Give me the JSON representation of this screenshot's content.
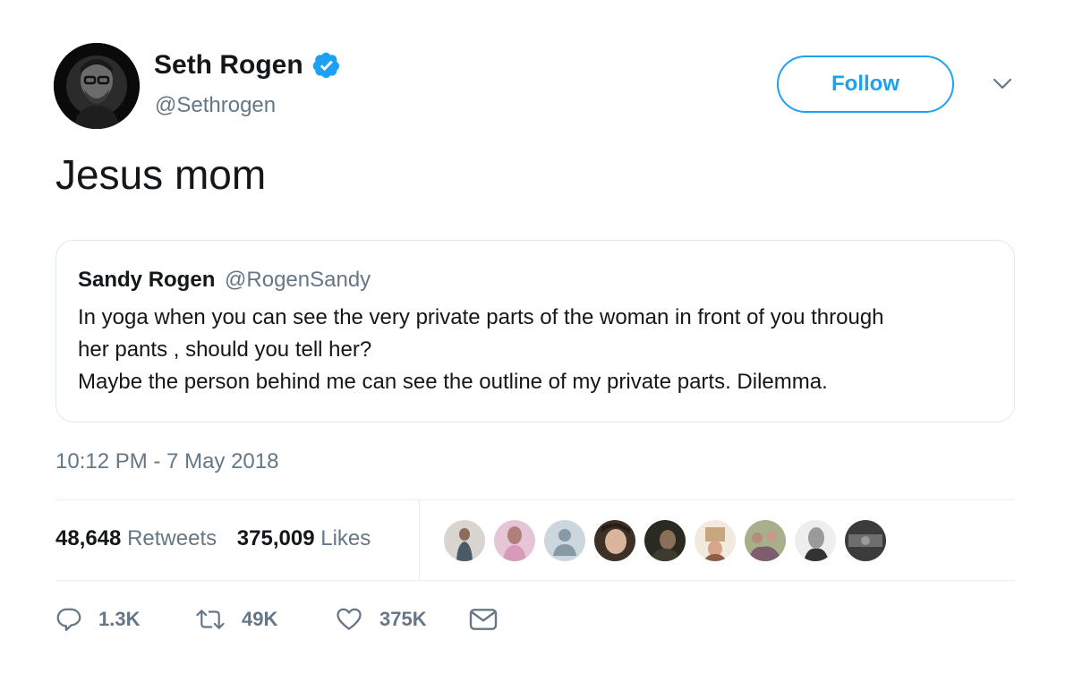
{
  "author": {
    "name": "Seth Rogen",
    "handle": "@Sethrogen",
    "verified_icon": "verified-badge-icon",
    "verified_color": "#1da1f2"
  },
  "follow_label": "Follow",
  "tweet_text": "Jesus mom",
  "quoted_tweet": {
    "name": "Sandy Rogen",
    "handle": "@RogenSandy",
    "lines": [
      "In yoga when you can see the very private parts of the woman in front of you through",
      "her pants , should you tell her?",
      "Maybe the person behind  me can see the outline of my private parts. Dilemma."
    ]
  },
  "timestamp": "10:12 PM - 7 May 2018",
  "stats": {
    "retweets_count": "48,648",
    "retweets_label": "Retweets",
    "likes_count": "375,009",
    "likes_label": "Likes"
  },
  "liker_avatars_count": 9,
  "actions": {
    "reply_count": "1.3K",
    "retweet_count": "49K",
    "like_count": "375K"
  },
  "colors": {
    "accent": "#1da1f2",
    "secondary_text": "#657786",
    "primary_text": "#14171a",
    "border": "#e1e8ed"
  }
}
